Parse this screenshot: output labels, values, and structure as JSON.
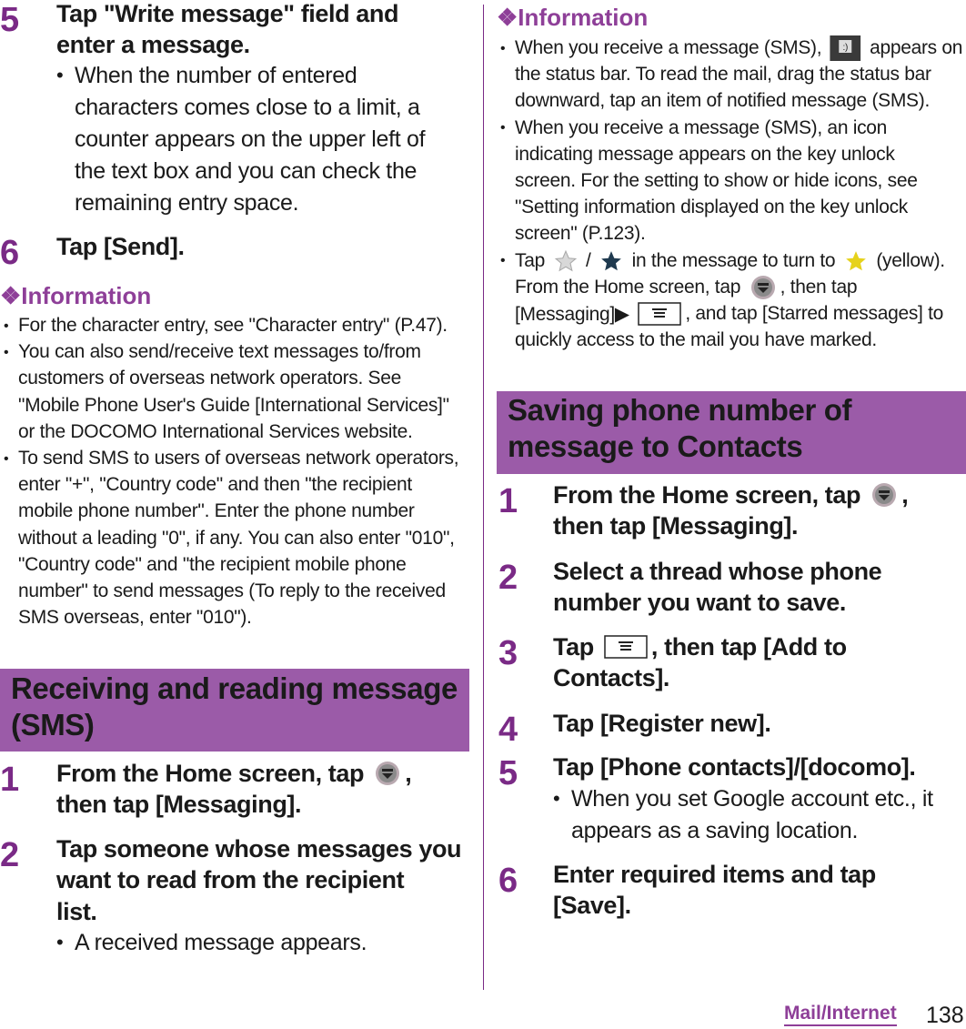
{
  "bullet": "•",
  "left": {
    "step5": {
      "number": "5",
      "lines": [
        "Tap \"Write message\" field and",
        "enter a message."
      ]
    },
    "step5_note": {
      "lines": [
        "When the number of entered",
        "characters comes close to a limit, a",
        "counter appears on the upper left of",
        "the text box and you can check the",
        "remaining entry space."
      ]
    },
    "step6": {
      "number": "6",
      "lines": [
        "Tap [Send]."
      ]
    },
    "info_heading": "❖Information",
    "info_bullets": [
      {
        "lines": [
          "For the character entry, see \"Character entry\" (P.47)."
        ]
      },
      {
        "lines": [
          "You can also send/receive text messages to/from",
          "customers of overseas network operators. See",
          "\"Mobile Phone User's Guide [International Services]\"",
          "or the DOCOMO International Services website."
        ]
      },
      {
        "lines": [
          "To send SMS to users of overseas network operators,",
          "enter \"+\", \"Country code\" and then \"the recipient",
          "mobile phone number\". Enter the phone number",
          "without a leading \"0\", if any. You can also enter \"010\",",
          "\"Country code\" and \"the recipient mobile phone",
          "number\" to send messages (To reply to the received",
          "SMS overseas, enter \"010\")."
        ]
      }
    ],
    "section_title": {
      "lines": [
        "Receiving and reading message",
        "(SMS)"
      ]
    },
    "step1": {
      "number": "1",
      "lines": [
        [
          "From the Home screen, tap ",
          {
            "icon": "apps-icon"
          },
          ","
        ],
        "then tap [Messaging]."
      ]
    },
    "step2": {
      "number": "2",
      "lines": [
        "Tap someone whose messages you",
        "want to read from the recipient",
        "list."
      ]
    },
    "step2_note": {
      "lines": [
        "A received message appears."
      ]
    }
  },
  "right": {
    "info_heading": "❖Information",
    "info_bullets": [
      {
        "lines": [
          [
            "When you receive a message (SMS), ",
            {
              "icon": "sms-notification-icon"
            },
            " appears on"
          ],
          "the status bar. To read the mail, drag the status bar",
          "downward, tap an item of notified message (SMS)."
        ]
      },
      {
        "lines": [
          "When you receive a message (SMS), an icon",
          "indicating message appears on the key unlock",
          "screen. For the setting to show or hide icons, see",
          "\"Setting information displayed on the key unlock",
          "screen\" (P.123)."
        ]
      },
      {
        "lines": [
          [
            "Tap ",
            {
              "icon": "star-gray-icon"
            },
            " / ",
            {
              "icon": "star-navy-icon"
            },
            " in the message to turn to ",
            {
              "icon": "star-yellow-icon"
            },
            " (yellow)."
          ],
          [
            "From the Home screen, tap ",
            {
              "icon": "apps-icon"
            },
            ", then tap"
          ],
          [
            "[Messaging]▶ ",
            {
              "icon": "menu-key-icon"
            },
            ", and tap [Starred messages] to"
          ],
          "quickly access to the mail you have marked."
        ]
      }
    ],
    "section_title": {
      "lines": [
        "Saving phone number of",
        "message to Contacts"
      ]
    },
    "step1": {
      "number": "1",
      "lines": [
        [
          "From the Home screen, tap ",
          {
            "icon": "apps-icon"
          },
          ","
        ],
        "then tap [Messaging]."
      ]
    },
    "step2": {
      "number": "2",
      "lines": [
        "Select a thread whose phone",
        "number you want to save."
      ]
    },
    "step3": {
      "number": "3",
      "lines": [
        [
          "Tap ",
          {
            "icon": "menu-key-icon"
          },
          ", then tap [Add to"
        ],
        "Contacts]."
      ]
    },
    "step4": {
      "number": "4",
      "lines": [
        "Tap [Register new]."
      ]
    },
    "step5": {
      "number": "5",
      "lines": [
        "Tap [Phone contacts]/[docomo]."
      ]
    },
    "step5_note": {
      "lines": [
        "When you set Google account etc., it",
        "appears as a saving location."
      ]
    },
    "step6": {
      "number": "6",
      "lines": [
        "Enter required items and tap",
        "[Save]."
      ]
    }
  },
  "footer": {
    "section": "Mail/Internet",
    "page": "138"
  },
  "colors": {
    "accent": "#9b5ba8",
    "number": "#7a2a86",
    "heading": "#8e3f98"
  }
}
